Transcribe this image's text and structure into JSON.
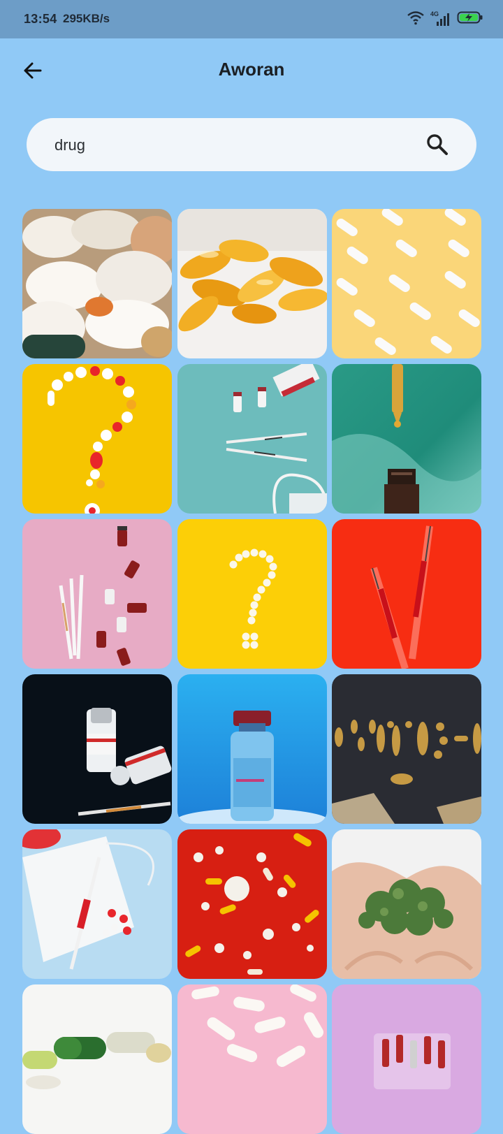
{
  "status_bar": {
    "time": "13:54",
    "speed": "295KB/s",
    "network": "4G",
    "icons": [
      "wifi-icon",
      "signal-icon",
      "battery-charging-icon"
    ]
  },
  "app_bar": {
    "title": "Aworan",
    "back_icon": "arrow-left-icon"
  },
  "search": {
    "value": "drug",
    "icon": "search-icon"
  },
  "colors": {
    "background": "#90c9f6",
    "status_bar": "#6d9dc7",
    "search_field": "#f2f6fa"
  },
  "results": [
    {
      "subject": "white pills pile"
    },
    {
      "subject": "amber softgel capsules"
    },
    {
      "subject": "white capsules on yellow"
    },
    {
      "subject": "pill question mark on yellow"
    },
    {
      "subject": "vials and syringes on teal"
    },
    {
      "subject": "dropper over bottle"
    },
    {
      "subject": "syringes and vials on pink"
    },
    {
      "subject": "white pill question mark"
    },
    {
      "subject": "red syringes on red"
    },
    {
      "subject": "covid vaccine vials on black"
    },
    {
      "subject": "covid-19 vaccine vial on blue"
    },
    {
      "subject": "covid pills lettering"
    },
    {
      "subject": "mask and syringe on blue"
    },
    {
      "subject": "scattered pills on red"
    },
    {
      "subject": "hands holding cannabis"
    },
    {
      "subject": "green and white capsules"
    },
    {
      "subject": "white capsules on pink"
    },
    {
      "subject": "ampoules on purple"
    }
  ]
}
